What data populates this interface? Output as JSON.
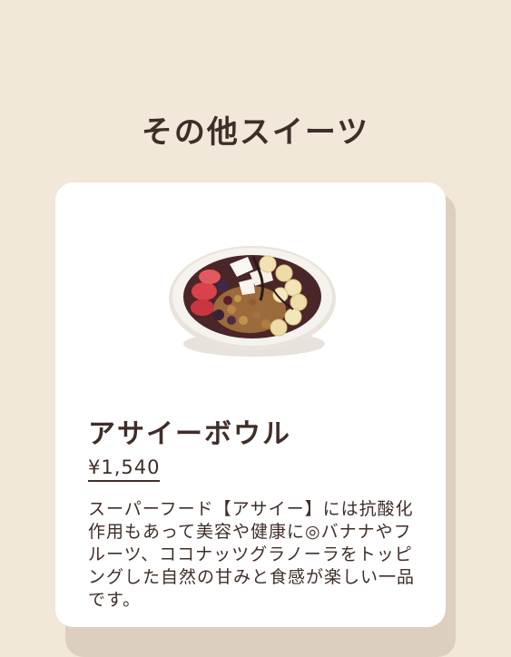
{
  "section": {
    "title": "その他スイーツ"
  },
  "product": {
    "name": "アサイーボウル",
    "price": "¥1,540",
    "description": "スーパーフード【アサイー】には抗酸化作用もあって美容や健康に◎バナナやフルーツ、ココナッツグラノーラをトッピングした自然の甘みと食感が楽しい一品です。",
    "image_icon": "acai-bowl-image"
  },
  "colors": {
    "background": "#f1e8da",
    "card": "#ffffff",
    "card_shadow": "#dccfbf",
    "text": "#3f2e28"
  }
}
